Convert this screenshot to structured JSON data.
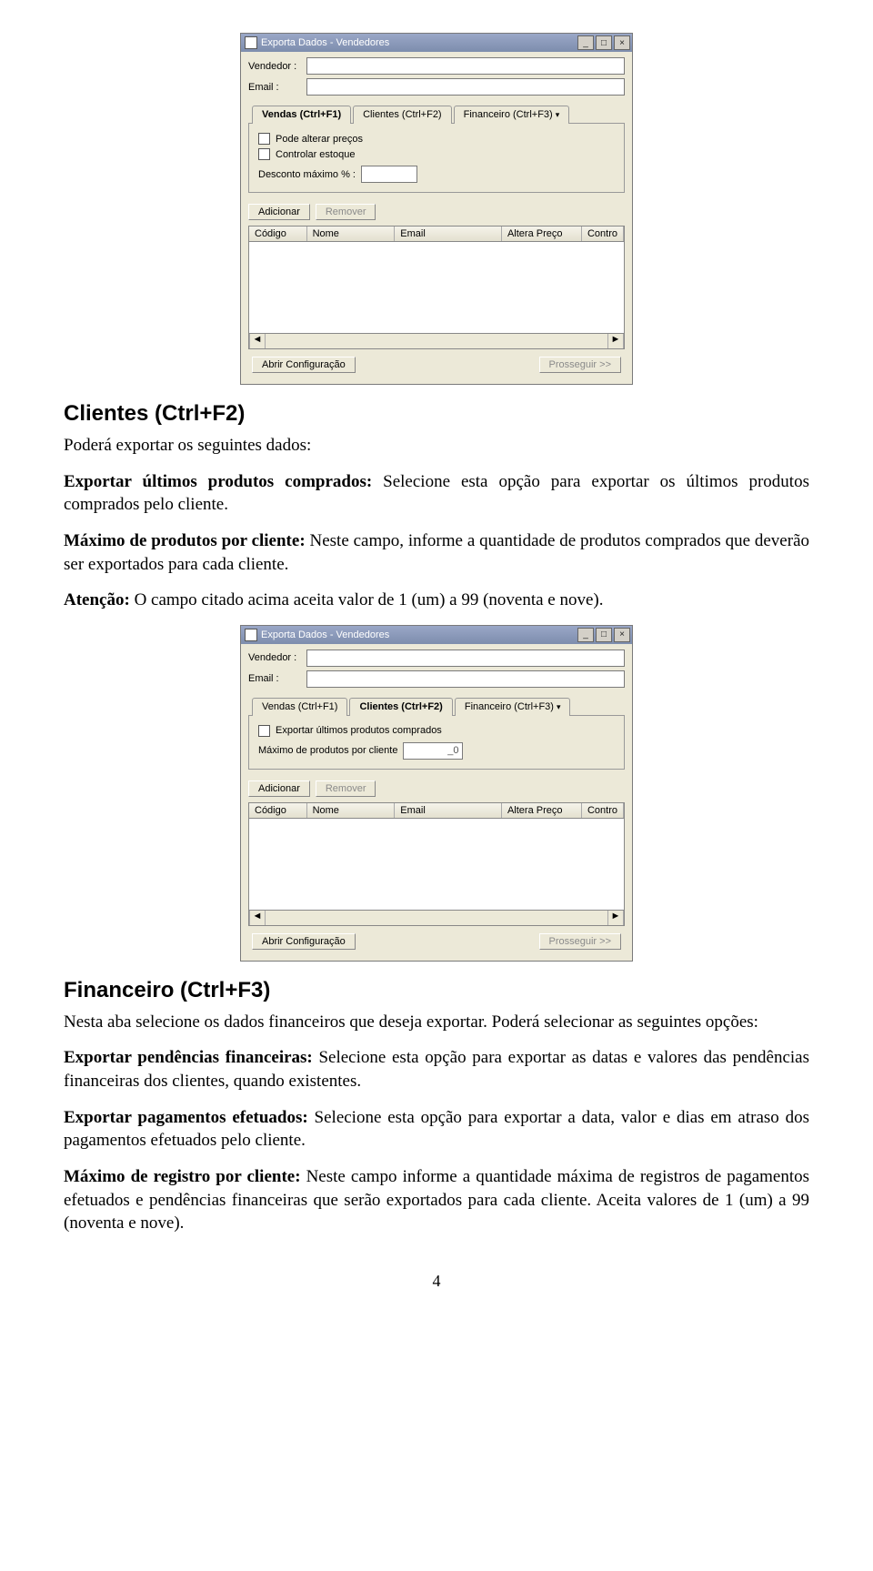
{
  "win1": {
    "title": "Exporta Dados - Vendedores",
    "labels": {
      "vendedor": "Vendedor :",
      "email": "Email :",
      "desconto": "Desconto máximo % :"
    },
    "tabs": {
      "vendas": "Vendas (Ctrl+F1)",
      "clientes": "Clientes (Ctrl+F2)",
      "financeiro": "Financeiro (Ctrl+F3)"
    },
    "checks": {
      "alterar": "Pode alterar preços",
      "estoque": "Controlar estoque"
    },
    "buttons": {
      "adicionar": "Adicionar",
      "remover": "Remover",
      "abrir": "Abrir Configuração",
      "prosseguir": "Prosseguir >>"
    },
    "grid": {
      "c1": "Código",
      "c2": "Nome",
      "c3": "Email",
      "c4": "Altera Preço",
      "c5": "Contro"
    }
  },
  "sec2": {
    "heading": "Clientes (Ctrl+F2)",
    "p1": "Poderá exportar os seguintes dados:",
    "p2a": "Exportar últimos produtos comprados:",
    "p2b": " Selecione esta opção para exportar os últimos produtos comprados pelo cliente.",
    "p3a": "Máximo de produtos por cliente:",
    "p3b": " Neste campo, informe a quantidade de produtos comprados que deverão ser exportados para cada cliente.",
    "p4a": "Atenção:",
    "p4b": " O campo citado acima aceita valor de 1 (um) a 99 (noventa e nove)."
  },
  "win2": {
    "title": "Exporta Dados - Vendedores",
    "labels": {
      "vendedor": "Vendedor :",
      "email": "Email :",
      "maxprod": "Máximo de produtos por cliente"
    },
    "maxprod_value": "_0",
    "tabs": {
      "vendas": "Vendas (Ctrl+F1)",
      "clientes": "Clientes (Ctrl+F2)",
      "financeiro": "Financeiro (Ctrl+F3)"
    },
    "checks": {
      "exp": "Exportar últimos produtos comprados"
    },
    "buttons": {
      "adicionar": "Adicionar",
      "remover": "Remover",
      "abrir": "Abrir Configuração",
      "prosseguir": "Prosseguir >>"
    },
    "grid": {
      "c1": "Código",
      "c2": "Nome",
      "c3": "Email",
      "c4": "Altera Preço",
      "c5": "Contro"
    }
  },
  "sec3": {
    "heading": "Financeiro (Ctrl+F3)",
    "p1": "Nesta aba selecione os dados financeiros que deseja exportar. Poderá selecionar as seguintes opções:",
    "p2a": "Exportar pendências financeiras:",
    "p2b": " Selecione esta opção para exportar as datas e valores das pendências financeiras dos clientes, quando existentes.",
    "p3a": "Exportar pagamentos efetuados:",
    "p3b": " Selecione esta opção para exportar a data, valor e dias em atraso dos pagamentos efetuados pelo cliente.",
    "p4a": "Máximo de registro por cliente:",
    "p4b": " Neste campo informe a quantidade máxima de registros de pagamentos efetuados e pendências financeiras que serão exportados para cada cliente. Aceita valores de 1 (um) a 99 (noventa e nove)."
  },
  "pagenum": "4",
  "glyphs": {
    "min": "_",
    "max": "□",
    "close": "×",
    "tri": "▾",
    "left": "◄",
    "right": "►"
  }
}
